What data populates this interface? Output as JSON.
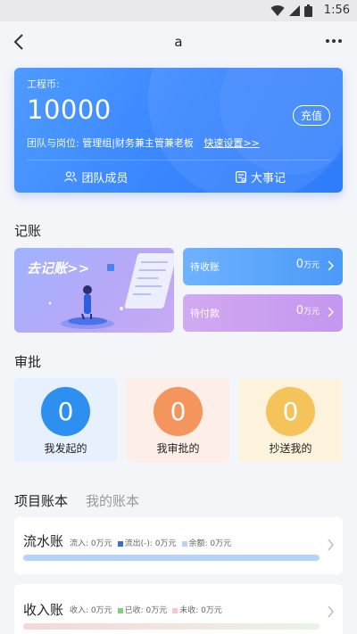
{
  "status": {
    "time": "1:56"
  },
  "nav": {
    "title": "a"
  },
  "card": {
    "coin_label": "工程币:",
    "coin_value": "10000",
    "recharge_label": "充值",
    "team_label": "团队与岗位:",
    "team_value": "管理组|财务兼主管兼老板",
    "quick_setup": "快速设置>>",
    "actions": [
      {
        "label": "团队成员",
        "icon": "team-icon"
      },
      {
        "label": "大事记",
        "icon": "event-icon"
      }
    ]
  },
  "ledger": {
    "title": "记账",
    "go_label": "去记账>>",
    "receivable": {
      "label": "待收账",
      "amount": "0",
      "unit": "万元"
    },
    "payable": {
      "label": "待付款",
      "amount": "0",
      "unit": "万元"
    }
  },
  "approval": {
    "title": "审批",
    "items": [
      {
        "count": "0",
        "label": "我发起的",
        "color": "#2d8ff0"
      },
      {
        "count": "0",
        "label": "我审批的",
        "color": "#f4955e"
      },
      {
        "count": "0",
        "label": "抄送我的",
        "color": "#f4c35a"
      }
    ]
  },
  "tabs": [
    "项目账本",
    "我的账本"
  ],
  "accounts": [
    {
      "name": "流水账",
      "metrics": [
        {
          "text": "流入: 0万元",
          "color": ""
        },
        {
          "text": "流出(-): 0万元",
          "color": "#3a6fd0"
        },
        {
          "text": "余额: 0万元",
          "color": "#b5d4f8"
        }
      ]
    },
    {
      "name": "收入账",
      "metrics": [
        {
          "text": "收入: 0万元",
          "color": ""
        },
        {
          "text": "已收: 0万元",
          "color": "#7fd17a"
        },
        {
          "text": "未收: 0万元",
          "color": "#f2c9c9"
        }
      ]
    }
  ]
}
